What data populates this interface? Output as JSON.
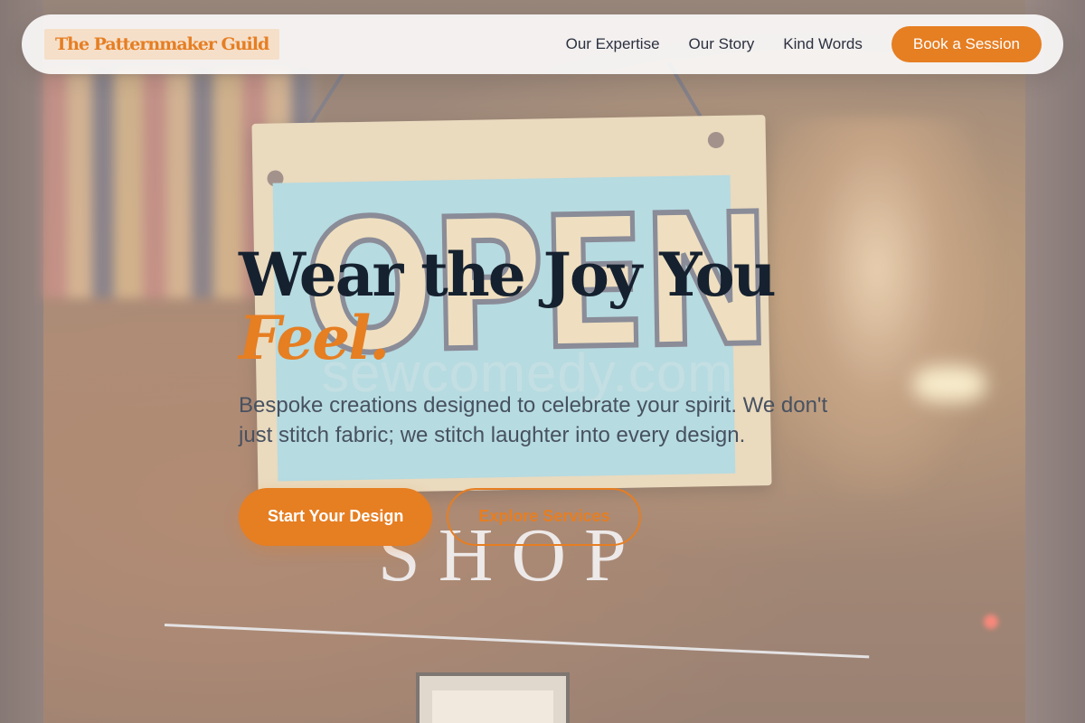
{
  "nav": {
    "brand": "The Patternmaker Guild",
    "links": [
      "Our Expertise",
      "Our Story",
      "Kind Words"
    ],
    "cta": "Book a Session"
  },
  "hero": {
    "title_line1": "Wear the Joy You",
    "title_accent": "Feel.",
    "subtitle": "Bespoke creations designed to celebrate your spirit. We don't just stitch fabric; we stitch laughter into every design.",
    "primary_cta": "Start Your Design",
    "secondary_cta": "Explore Services"
  },
  "background": {
    "sign_text": "OPEN",
    "shop_text": "SHOP",
    "watermark": "sewcomedy.com"
  },
  "colors": {
    "accent": "#e67e22",
    "heading": "#16212f",
    "body_text": "#475160"
  }
}
